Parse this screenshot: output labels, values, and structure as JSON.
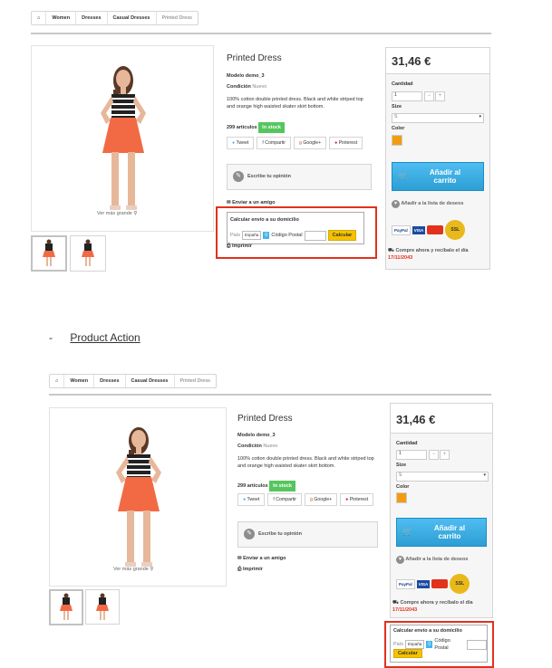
{
  "breadcrumb": {
    "home_icon": "home-icon",
    "items": [
      "Women",
      "Dresses",
      "Casual Dresses",
      "Printed Dress"
    ]
  },
  "product": {
    "name": "Printed Dress",
    "model_label": "Modelo",
    "model_value": "demo_3",
    "condition_label": "Condición",
    "condition_value": "Nuevo",
    "description": "100% cotton double printed dress. Black and white striped top and orange high waisted skater skirt bottom.",
    "stock_count": "299 artículos",
    "stock_badge": "In stock",
    "zoom_label": "Ver más grande"
  },
  "social": {
    "tweet": "Tweet",
    "share": "Compartir",
    "google": "Google+",
    "pinterest": "Pinterest"
  },
  "review": {
    "label": "Escribe tu opinión"
  },
  "links": {
    "send_friend": "Enviar a un amigo",
    "print": "Imprimir"
  },
  "shipping": {
    "title": "Calcular envío a su domicilio",
    "country_label": "País",
    "country_value": "España",
    "badge": "0",
    "postcode_label": "Código Postal",
    "calc_button": "Calcular"
  },
  "buy": {
    "price": "31,46 €",
    "qty_label": "Cantidad",
    "qty_value": "1",
    "minus": "−",
    "plus": "+",
    "size_label": "Size",
    "size_value": "S",
    "color_label": "Color",
    "color_swatch": "#f39c11",
    "add_cart": "Añadir al carrito",
    "wishlist": "Añadir a la lista de deseos",
    "pay_paypal": "PayPal",
    "pay_visa": "VISA",
    "pay_master": "MasterCard",
    "seal": "SSL",
    "buy_now": "Compre ahora y recíbalo el día",
    "buy_date": "17/11/2043"
  },
  "section": {
    "dash": "-",
    "title": "Product Action"
  },
  "colors": {
    "accent": "#43b5ea",
    "stock": "#55c65e",
    "highlight": "#e0321c",
    "calc": "#f5c200"
  }
}
